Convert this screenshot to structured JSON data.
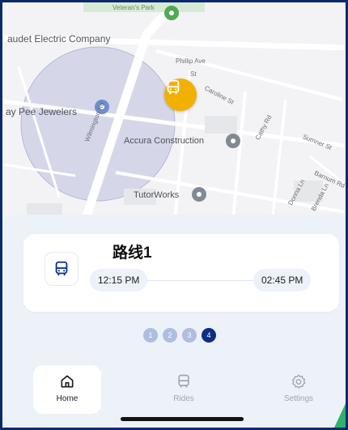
{
  "map": {
    "labels": {
      "veterans_park": "Veteran's Park",
      "gaudet": "audet Electric Company",
      "phillip_ave": "Phillip Ave",
      "st_short": "St",
      "caroline_st": "Caroline St",
      "jewelers": "ay Pee Jewelers",
      "wilmington_rd": "Wilmington Rd",
      "accura": "Accura Construction",
      "cathy_rd": "Cathy Rd",
      "sumner_st": "Sumner St",
      "barnum_rd": "Barnum Rd",
      "tutorworks": "TutorWorks",
      "donna_ln": "Donna Ln",
      "brenda_ln": "Brenda Ln"
    }
  },
  "route": {
    "title": "路线1",
    "start_time": "12:15 PM",
    "end_time": "02:45 PM"
  },
  "pager": {
    "pages": [
      "1",
      "2",
      "3",
      "4"
    ],
    "active_index": 3
  },
  "tabs": {
    "home": "Home",
    "rides": "Rides",
    "settings": "Settings"
  },
  "colors": {
    "accent": "#0c2f86",
    "bus_marker": "#f2b000",
    "frame_border": "#0b2a6b",
    "green_pin": "#2fb36c"
  },
  "icons": {
    "marker": "bus-icon",
    "route": "bus-icon",
    "home": "home-icon",
    "rides": "bus-icon",
    "settings": "gear-icon"
  }
}
